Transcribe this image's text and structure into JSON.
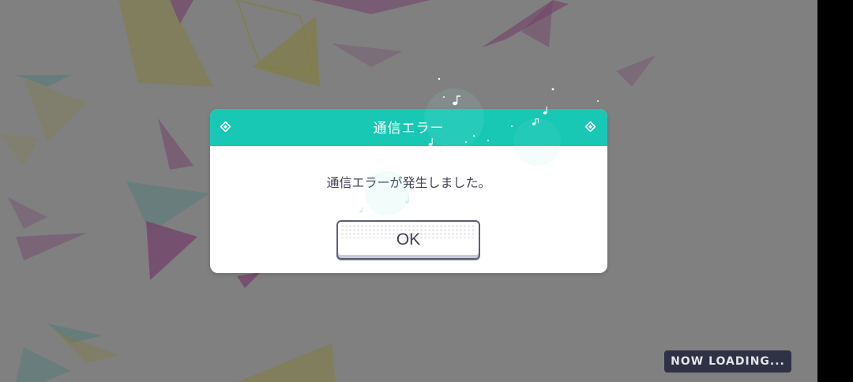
{
  "dialog": {
    "title": "通信エラー",
    "message": "通信エラーが発生しました。",
    "ok_label": "OK"
  },
  "loading": {
    "text": "NOW LOADING..."
  },
  "colors": {
    "header": "#18c8b4",
    "overlay": "rgba(0,0,0,0.47)",
    "button_border": "#5d5f72",
    "loading_badge": "#2f3144",
    "accent_pink": "#d980c8",
    "accent_yellow": "#f3ec7a",
    "accent_cyan": "#8fe6e0"
  },
  "icons": [
    "diamond-icon",
    "music-note-icon",
    "sparkle-icon"
  ]
}
